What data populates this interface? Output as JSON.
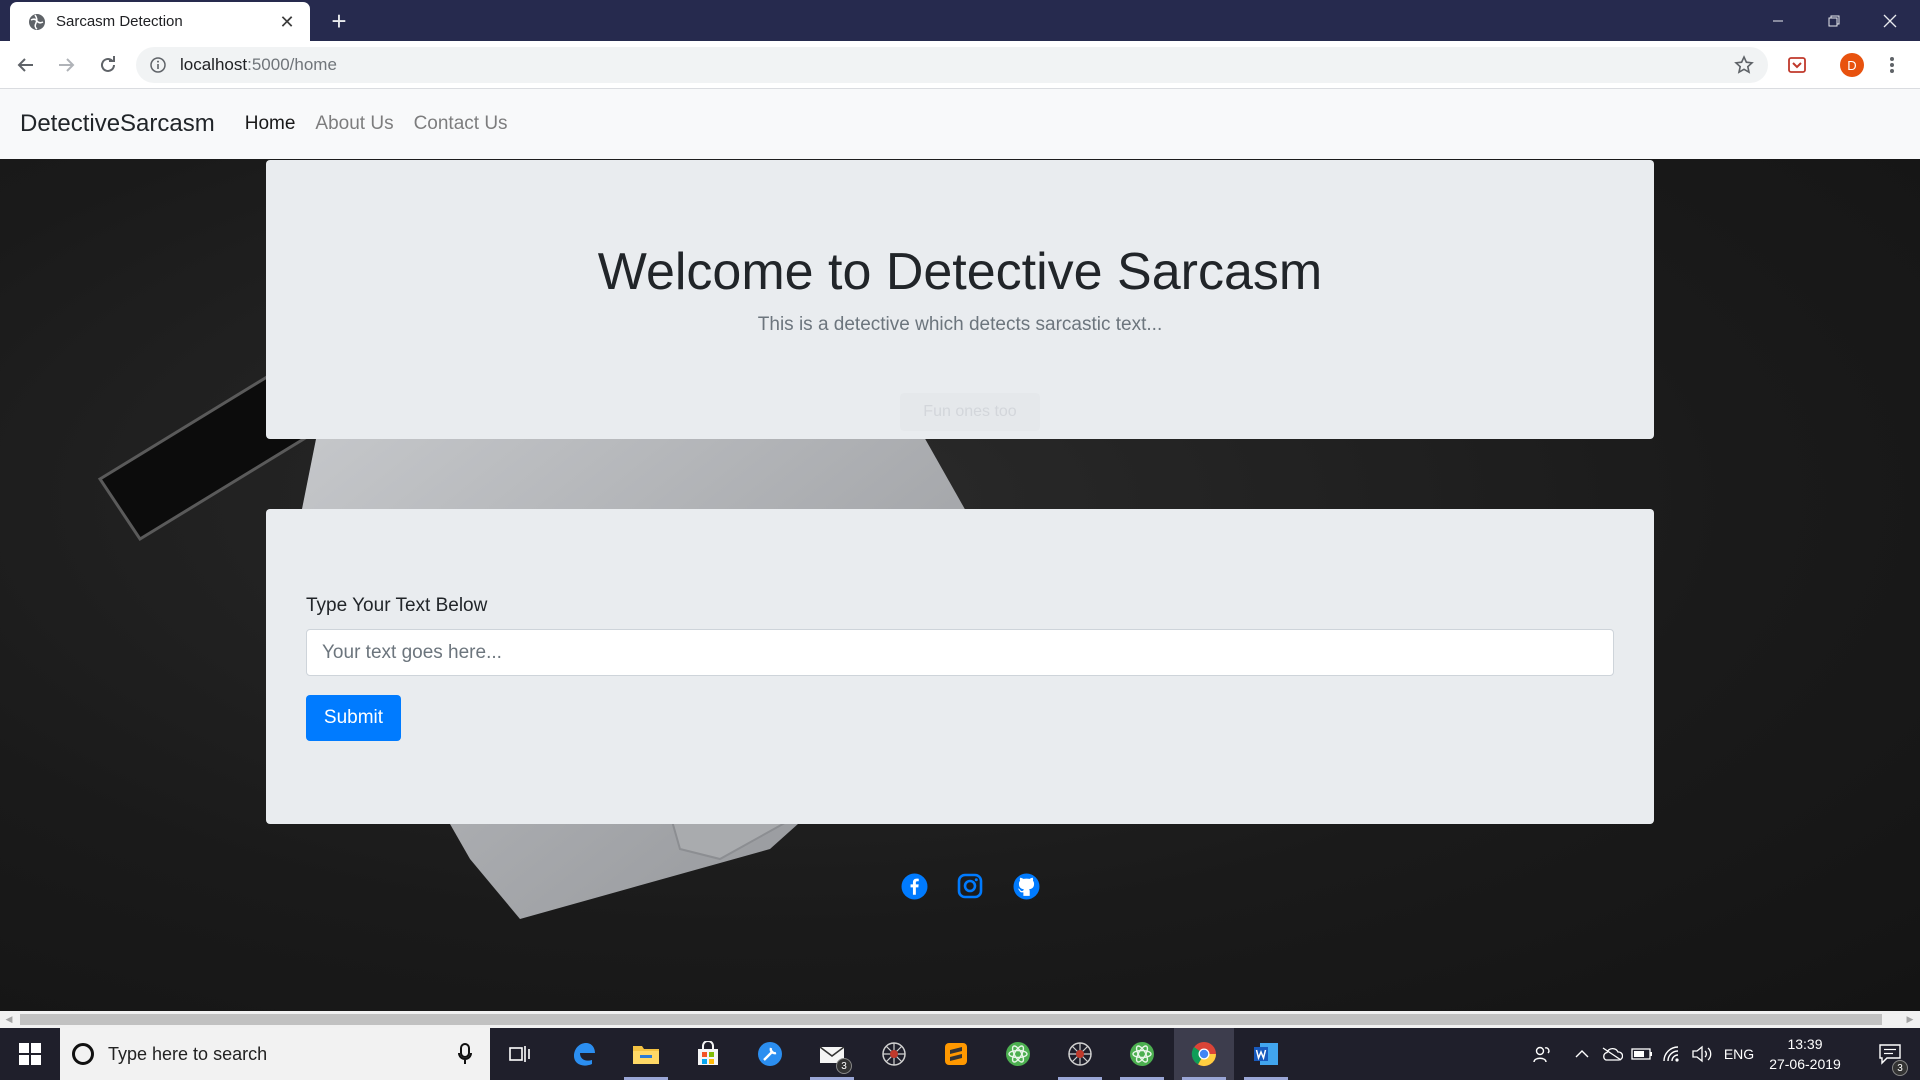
{
  "browser": {
    "tab_title": "Sarcasm Detection",
    "url_host": "localhost",
    "url_path": ":5000/home",
    "profile_initial": "D"
  },
  "navbar": {
    "brand": "DetectiveSarcasm",
    "links": [
      {
        "label": "Home",
        "active": true
      },
      {
        "label": "About Us",
        "active": false
      },
      {
        "label": "Contact Us",
        "active": false
      }
    ]
  },
  "jumbotron": {
    "title": "Welcome to Detective Sarcasm",
    "subtitle": "This is a detective which detects sarcastic text...",
    "faded_button": "Fun ones too"
  },
  "form": {
    "label": "Type Your Text Below",
    "placeholder": "Your text goes here...",
    "value": "",
    "submit_label": "Submit"
  },
  "social": [
    "facebook-icon",
    "instagram-icon",
    "github-icon"
  ],
  "colors": {
    "primary": "#007bff",
    "navbar_bg": "#f8f9fa",
    "card_bg": "#e9ecef",
    "tabstrip_bg": "#262a4e"
  },
  "taskbar": {
    "search_placeholder": "Type here to search",
    "mail_badge": "3",
    "language": "ENG",
    "time": "13:39",
    "date": "27-06-2019",
    "notification_count": "3"
  }
}
